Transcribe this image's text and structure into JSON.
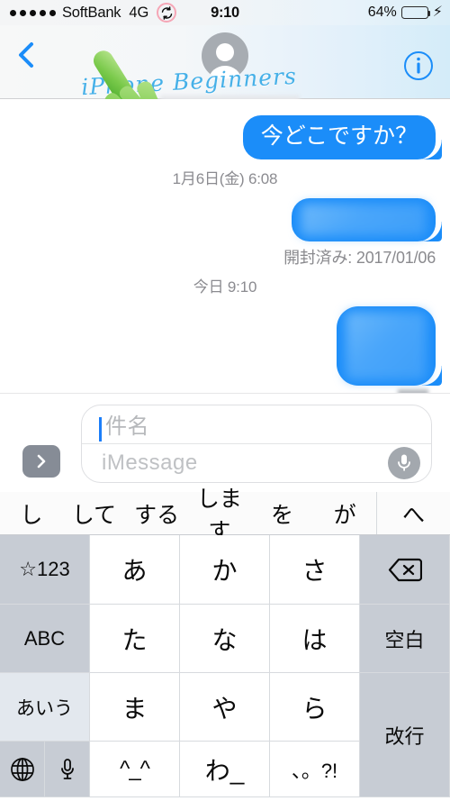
{
  "status_bar": {
    "signal_dots": 5,
    "carrier": "SoftBank",
    "network": "4G",
    "sync_icon": "sync-icon",
    "time": "9:10",
    "battery_percent": "64%",
    "battery_level": 64,
    "charging": true,
    "annotation_color": "#f5a6b6"
  },
  "nav_bar": {
    "back_icon": "back-chevron-icon",
    "avatar_icon": "person-avatar-icon",
    "contact_name": "",
    "watermark": "iPhone Beginners",
    "info_icon": "info-circle-icon"
  },
  "thread": {
    "messages": [
      {
        "id": "msg-1",
        "side": "outgoing",
        "text": "今どこですか？",
        "redacted": false
      },
      {
        "id": "msg-2",
        "side": "outgoing",
        "text": "",
        "redacted": true
      },
      {
        "id": "msg-3",
        "side": "outgoing",
        "text": "",
        "redacted": true
      }
    ],
    "separator_1": "1月6日(金)  6:08",
    "separator_2": "今日 9:10",
    "read_receipt": "開封済み: 2017/01/06",
    "bubble_color": "#1b8df9"
  },
  "input_bar": {
    "expand_icon": "chevron-right-icon",
    "subject_placeholder": "件名",
    "subject_value": "",
    "message_placeholder": "iMessage",
    "message_value": "",
    "mic_icon": "microphone-icon",
    "caret_color": "#1b7ef9"
  },
  "keyboard": {
    "predictions": [
      "し",
      "して",
      "する",
      "します",
      "を",
      "が"
    ],
    "prediction_expand": "へ",
    "rows": [
      [
        {
          "label": "☆123",
          "name": "key-symbols-numbers",
          "type": "fn"
        },
        {
          "label": "あ",
          "name": "key-a-row",
          "type": "char"
        },
        {
          "label": "か",
          "name": "key-ka-row",
          "type": "char"
        },
        {
          "label": "さ",
          "name": "key-sa-row",
          "type": "char"
        },
        {
          "label": "⌫",
          "name": "key-delete",
          "type": "fn-icon"
        }
      ],
      [
        {
          "label": "ABC",
          "name": "key-abc",
          "type": "fn"
        },
        {
          "label": "た",
          "name": "key-ta-row",
          "type": "char"
        },
        {
          "label": "な",
          "name": "key-na-row",
          "type": "char"
        },
        {
          "label": "は",
          "name": "key-ha-row",
          "type": "char"
        },
        {
          "label": "空白",
          "name": "key-space",
          "type": "fn"
        }
      ],
      [
        {
          "label": "あいう",
          "name": "key-aiu",
          "type": "fn-light"
        },
        {
          "label": "ま",
          "name": "key-ma-row",
          "type": "char"
        },
        {
          "label": "や",
          "name": "key-ya-row",
          "type": "char"
        },
        {
          "label": "ら",
          "name": "key-ra-row",
          "type": "char"
        },
        {
          "label": "改行",
          "name": "key-return",
          "type": "fn"
        }
      ],
      [
        {
          "label": "🌐",
          "name": "key-globe",
          "type": "fn-icon"
        },
        {
          "label": "🎤",
          "name": "key-dictation",
          "type": "fn-icon"
        },
        {
          "label": "^_^",
          "name": "key-kaomoji",
          "type": "char"
        },
        {
          "label": "わ_",
          "name": "key-wa-row",
          "type": "char"
        },
        {
          "label": "、。?!",
          "name": "key-punctuation",
          "type": "char"
        }
      ]
    ]
  }
}
